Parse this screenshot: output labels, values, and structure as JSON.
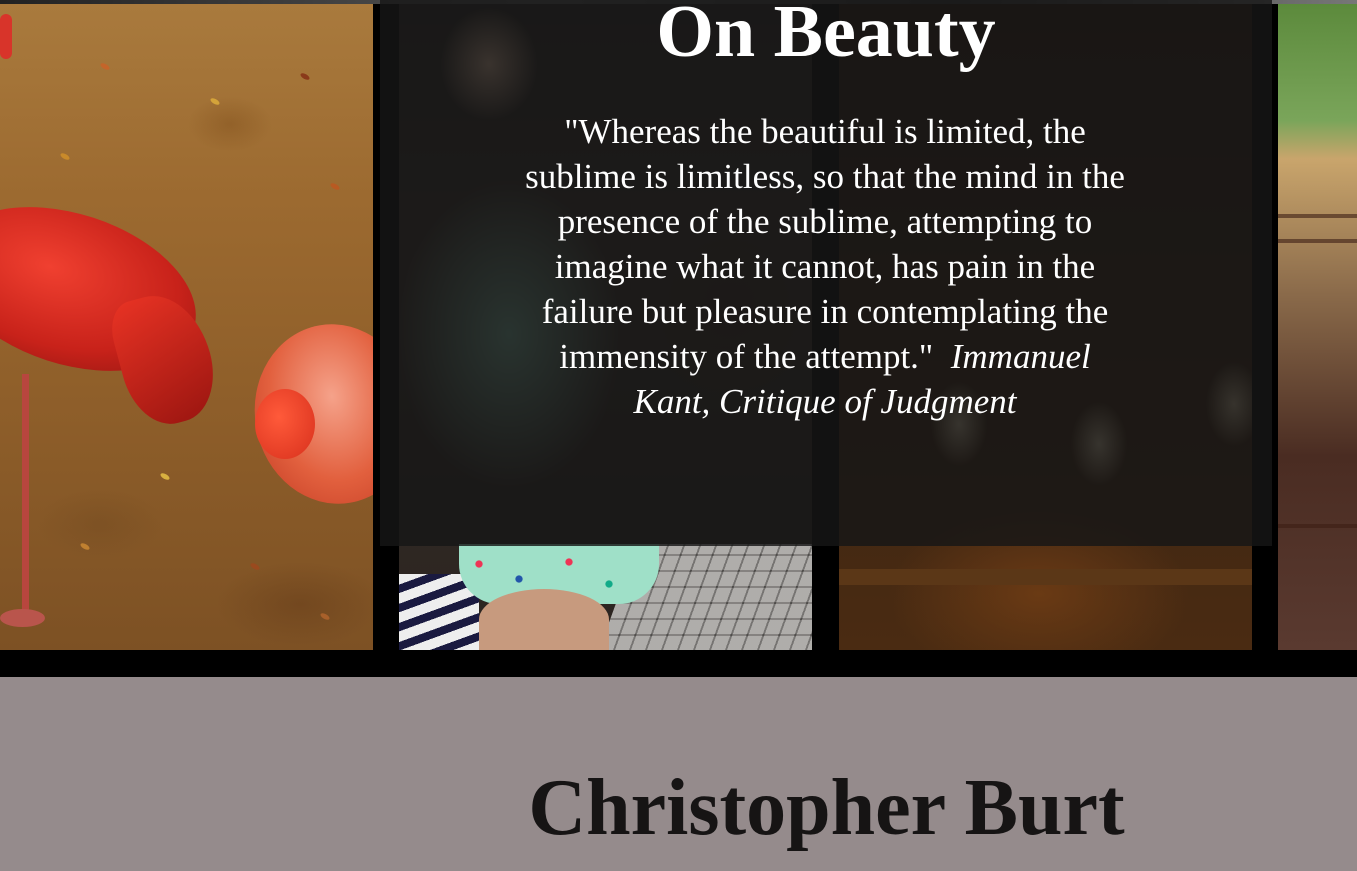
{
  "gallery": {
    "photos": [
      {
        "subject": "flamingos"
      },
      {
        "subject": "child being held"
      },
      {
        "subject": "warm interior"
      },
      {
        "subject": "partial photo"
      }
    ]
  },
  "quote": {
    "title": "On Beauty",
    "text": "\"Whereas the beautiful is limited, the sublime is limitless, so that the mind in the presence of the sublime, attempting to imagine what it cannot, has pain in the failure but pleasure in contemplating the immensity of the attempt.\"",
    "attribution": "Immanuel Kant, Critique of Judgment"
  },
  "author": {
    "name": "Christopher Burt"
  },
  "colors": {
    "panel": "#161616",
    "footer": "#958b8c",
    "author_text": "#161414",
    "quote_text": "#ffffff"
  }
}
